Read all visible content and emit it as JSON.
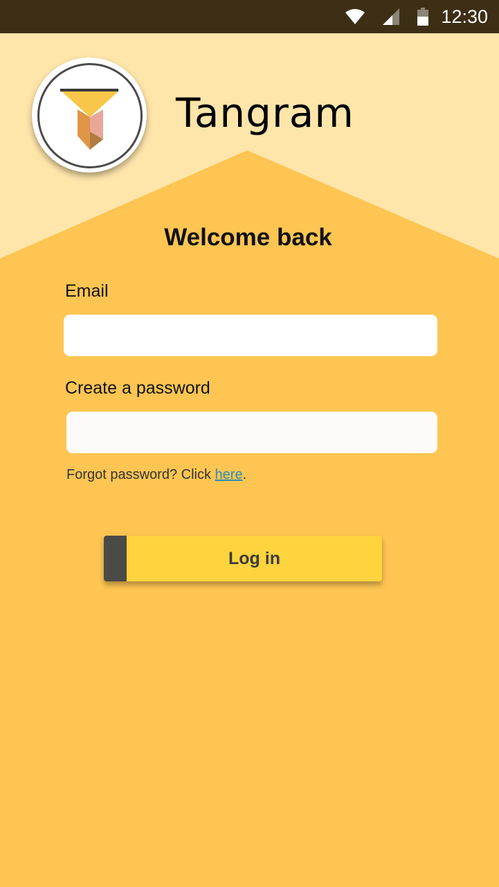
{
  "status_bar": {
    "time": "12:30",
    "icons": [
      "wifi-icon",
      "cell-signal-icon",
      "battery-icon"
    ],
    "background": "#3d2f16"
  },
  "header": {
    "app_name": "Tangram",
    "logo_icon": "tangram-logo-icon",
    "background_light": "#fee5aa",
    "background_dark": "#fec552"
  },
  "login_form": {
    "heading": "Welcome back",
    "email_label": "Email",
    "email_value": "",
    "password_label": "Create a password",
    "password_value": "",
    "forgot_text": "Forgot password? Click ",
    "forgot_link": "here",
    "forgot_suffix": ".",
    "submit_label": "Log in",
    "button_color": "#fed33d",
    "link_color": "#2b8fb7"
  }
}
